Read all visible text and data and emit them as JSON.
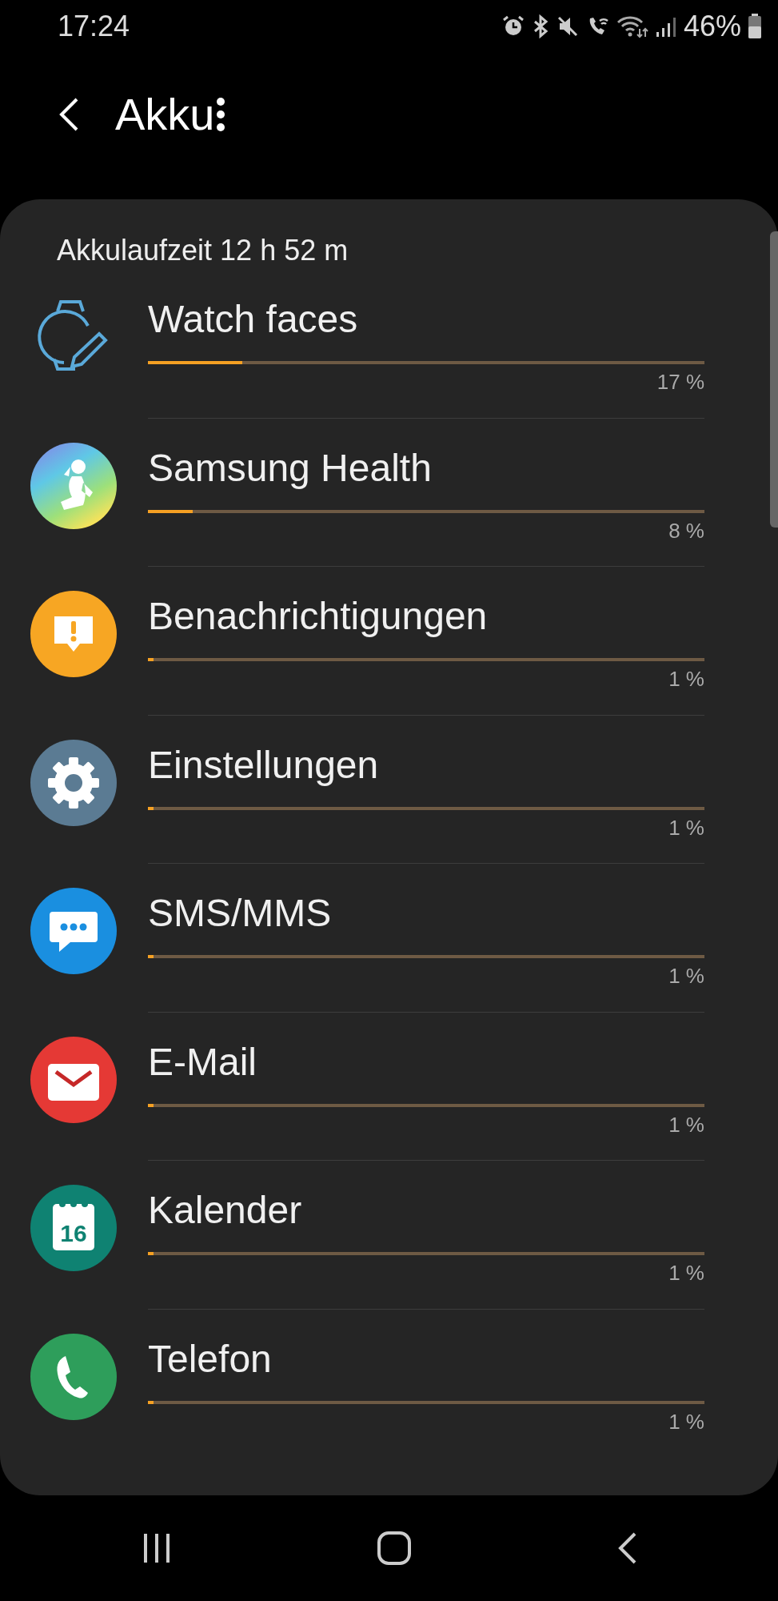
{
  "status_bar": {
    "time": "17:24",
    "battery": "46%"
  },
  "header": {
    "title": "Akku"
  },
  "summary": "Akkulaufzeit 12 h 52 m",
  "apps": [
    {
      "name": "Watch faces",
      "kind": "watch",
      "level": 0.17,
      "percent": "17 %"
    },
    {
      "name": "Samsung Health",
      "kind": "health",
      "level": 0.08,
      "percent": "8 %"
    },
    {
      "name": "Benachrichtigungen",
      "kind": "notification",
      "level": 0.01,
      "percent": "1 %"
    },
    {
      "name": "Einstellungen",
      "kind": "settings",
      "level": 0.01,
      "percent": "1 %"
    },
    {
      "name": "SMS/MMS",
      "kind": "sms",
      "level": 0.01,
      "percent": "1 %"
    },
    {
      "name": "E-Mail",
      "kind": "email",
      "level": 0.01,
      "percent": "1 %"
    },
    {
      "name": "Kalender",
      "kind": "calendar",
      "icon_text": "16",
      "level": 0.01,
      "percent": "1 %"
    },
    {
      "name": "Telefon",
      "kind": "phone",
      "level": 0.01,
      "percent": "1 %"
    }
  ]
}
